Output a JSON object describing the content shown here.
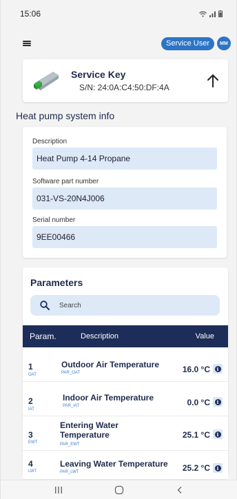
{
  "status": {
    "time": "15:06"
  },
  "header": {
    "user_role": "Service User",
    "avatar_initials": "MM"
  },
  "service_key": {
    "title": "Service Key",
    "serial": "S/N: 24:0A:C4:50:DF:4A"
  },
  "system_info": {
    "title": "Heat pump system info",
    "fields": [
      {
        "label": "Description",
        "value": "Heat Pump 4-14 Propane"
      },
      {
        "label": "Software part number",
        "value": "031-VS-20N4J006"
      },
      {
        "label": "Serial number",
        "value": "9EE00466"
      }
    ]
  },
  "parameters": {
    "title": "Parameters",
    "search_placeholder": "Search",
    "columns": {
      "param": "Param.",
      "description": "Description",
      "value": "Value"
    },
    "rows": [
      {
        "num": "1",
        "code": "OAT",
        "description": "Outdoor Air Temperature",
        "sub": "PAR_OAT",
        "value": "16.0 °C"
      },
      {
        "num": "2",
        "code": "IAT",
        "description": "Indoor Air Temperature",
        "sub": "PAR_IAT",
        "value": "0.0 °C"
      },
      {
        "num": "3",
        "code": "EWT",
        "description": "Entering Water Temperature",
        "sub": "PAR_EWT",
        "value": "25.1 °C"
      },
      {
        "num": "4",
        "code": "LWT",
        "description": "Leaving Water Temperature",
        "sub": "PAR_LWT",
        "value": "25.2 °C"
      }
    ]
  },
  "colors": {
    "accent": "#2d74c5",
    "header_bg": "#1d2d5a",
    "field_bg": "#dde9f7"
  }
}
